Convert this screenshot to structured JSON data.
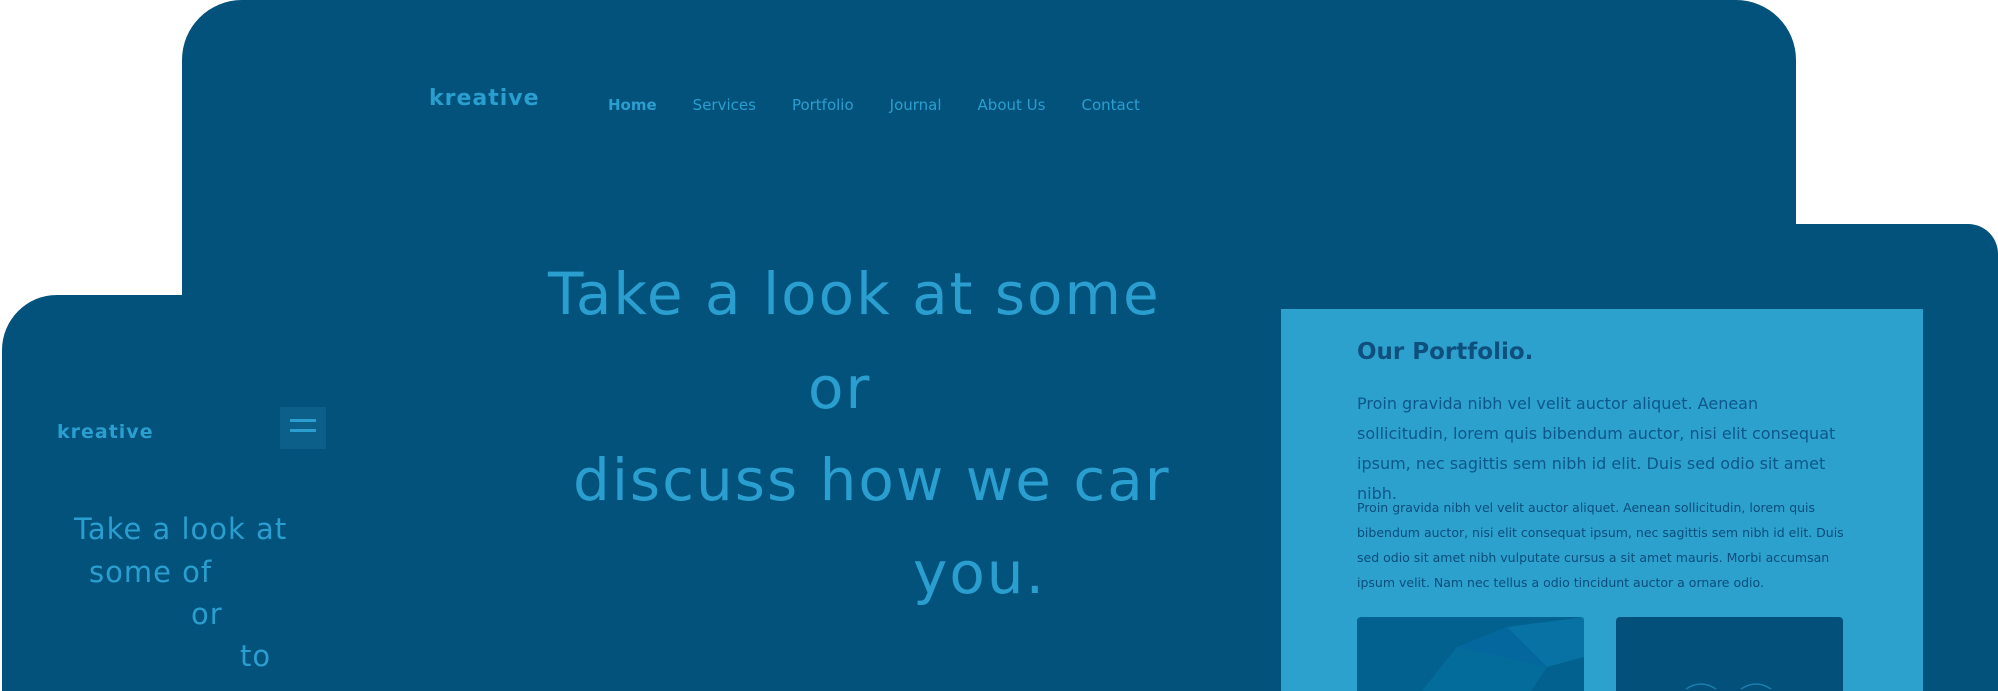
{
  "desktop": {
    "logo": "kreative",
    "nav": [
      "Home",
      "Services",
      "Portfolio",
      "Journal",
      "About Us",
      "Contact"
    ],
    "hero_lines": [
      "Take a look at some",
      "or",
      "discuss how we car",
      "you."
    ]
  },
  "phone": {
    "logo": "kreative",
    "menu_icon": "hamburger-icon",
    "hero_lines": [
      "Take a look at",
      "some of",
      "or",
      "to"
    ]
  },
  "tablet": {
    "title": "Our Portfolio.",
    "lead": "Proin gravida nibh vel velit auctor aliquet. Aenean sollicitudin, lorem quis bibendum auctor, nisi elit consequat ipsum, nec sagittis sem nibh id elit. Duis sed odio sit amet nibh.",
    "body": "Proin gravida nibh vel velit auctor aliquet. Aenean sollicitudin, lorem quis bibendum auctor, nisi elit consequat ipsum, nec sagittis sem nibh id elit. Duis sed odio sit amet nibh vulputate cursus a sit amet mauris. Morbi accumsan ipsum velit. Nam nec tellus a odio tincidunt auctor a ornare odio."
  },
  "colors": {
    "frame": "#02527b",
    "accent": "#2a9fcf",
    "panel": "#2da1cd"
  }
}
